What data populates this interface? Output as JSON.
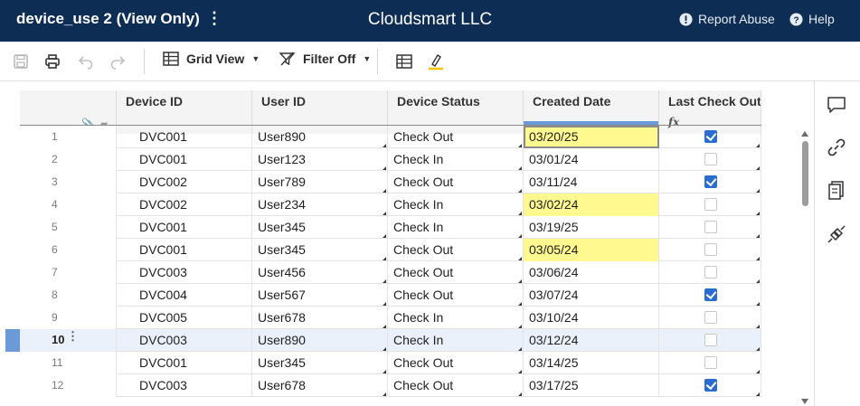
{
  "header": {
    "sheet_title": "device_use 2 (View Only)",
    "more_glyph": "⋮",
    "org_name": "Cloudsmart LLC",
    "report_abuse": "Report Abuse",
    "help": "Help"
  },
  "toolbar": {
    "view_label": "Grid View",
    "filter_label": "Filter Off"
  },
  "grid": {
    "columns": [
      "Device ID",
      "User ID",
      "Device Status",
      "Created Date",
      "Last Check Out"
    ],
    "formula_glyph": "fx",
    "rows": [
      {
        "num": "1",
        "device": "DVC001",
        "user": "User890",
        "status": "Check Out",
        "date": "03/20/25",
        "checked": true,
        "highlight": true,
        "focus": true
      },
      {
        "num": "2",
        "device": "DVC001",
        "user": "User123",
        "status": "Check In",
        "date": "03/01/24",
        "checked": false,
        "highlight": false
      },
      {
        "num": "3",
        "device": "DVC002",
        "user": "User789",
        "status": "Check Out",
        "date": "03/11/24",
        "checked": true,
        "highlight": false
      },
      {
        "num": "4",
        "device": "DVC002",
        "user": "User234",
        "status": "Check In",
        "date": "03/02/24",
        "checked": false,
        "highlight": true
      },
      {
        "num": "5",
        "device": "DVC001",
        "user": "User345",
        "status": "Check In",
        "date": "03/19/25",
        "checked": false,
        "highlight": false
      },
      {
        "num": "6",
        "device": "DVC001",
        "user": "User345",
        "status": "Check Out",
        "date": "03/05/24",
        "checked": false,
        "highlight": true
      },
      {
        "num": "7",
        "device": "DVC003",
        "user": "User456",
        "status": "Check Out",
        "date": "03/06/24",
        "checked": false,
        "highlight": false
      },
      {
        "num": "8",
        "device": "DVC004",
        "user": "User567",
        "status": "Check Out",
        "date": "03/07/24",
        "checked": true,
        "highlight": false
      },
      {
        "num": "9",
        "device": "DVC005",
        "user": "User678",
        "status": "Check In",
        "date": "03/10/24",
        "checked": false,
        "highlight": false
      },
      {
        "num": "10",
        "device": "DVC003",
        "user": "User890",
        "status": "Check In",
        "date": "03/12/24",
        "checked": false,
        "highlight": false,
        "active": true
      },
      {
        "num": "11",
        "device": "DVC001",
        "user": "User345",
        "status": "Check Out",
        "date": "03/14/25",
        "checked": false,
        "highlight": false
      },
      {
        "num": "12",
        "device": "DVC003",
        "user": "User678",
        "status": "Check Out",
        "date": "03/17/25",
        "checked": true,
        "highlight": false
      }
    ]
  },
  "colors": {
    "topbar": "#0d2d55",
    "highlight": "#fff98f",
    "checkbox": "#2a6ccf",
    "selection": "#6a9ad8"
  }
}
